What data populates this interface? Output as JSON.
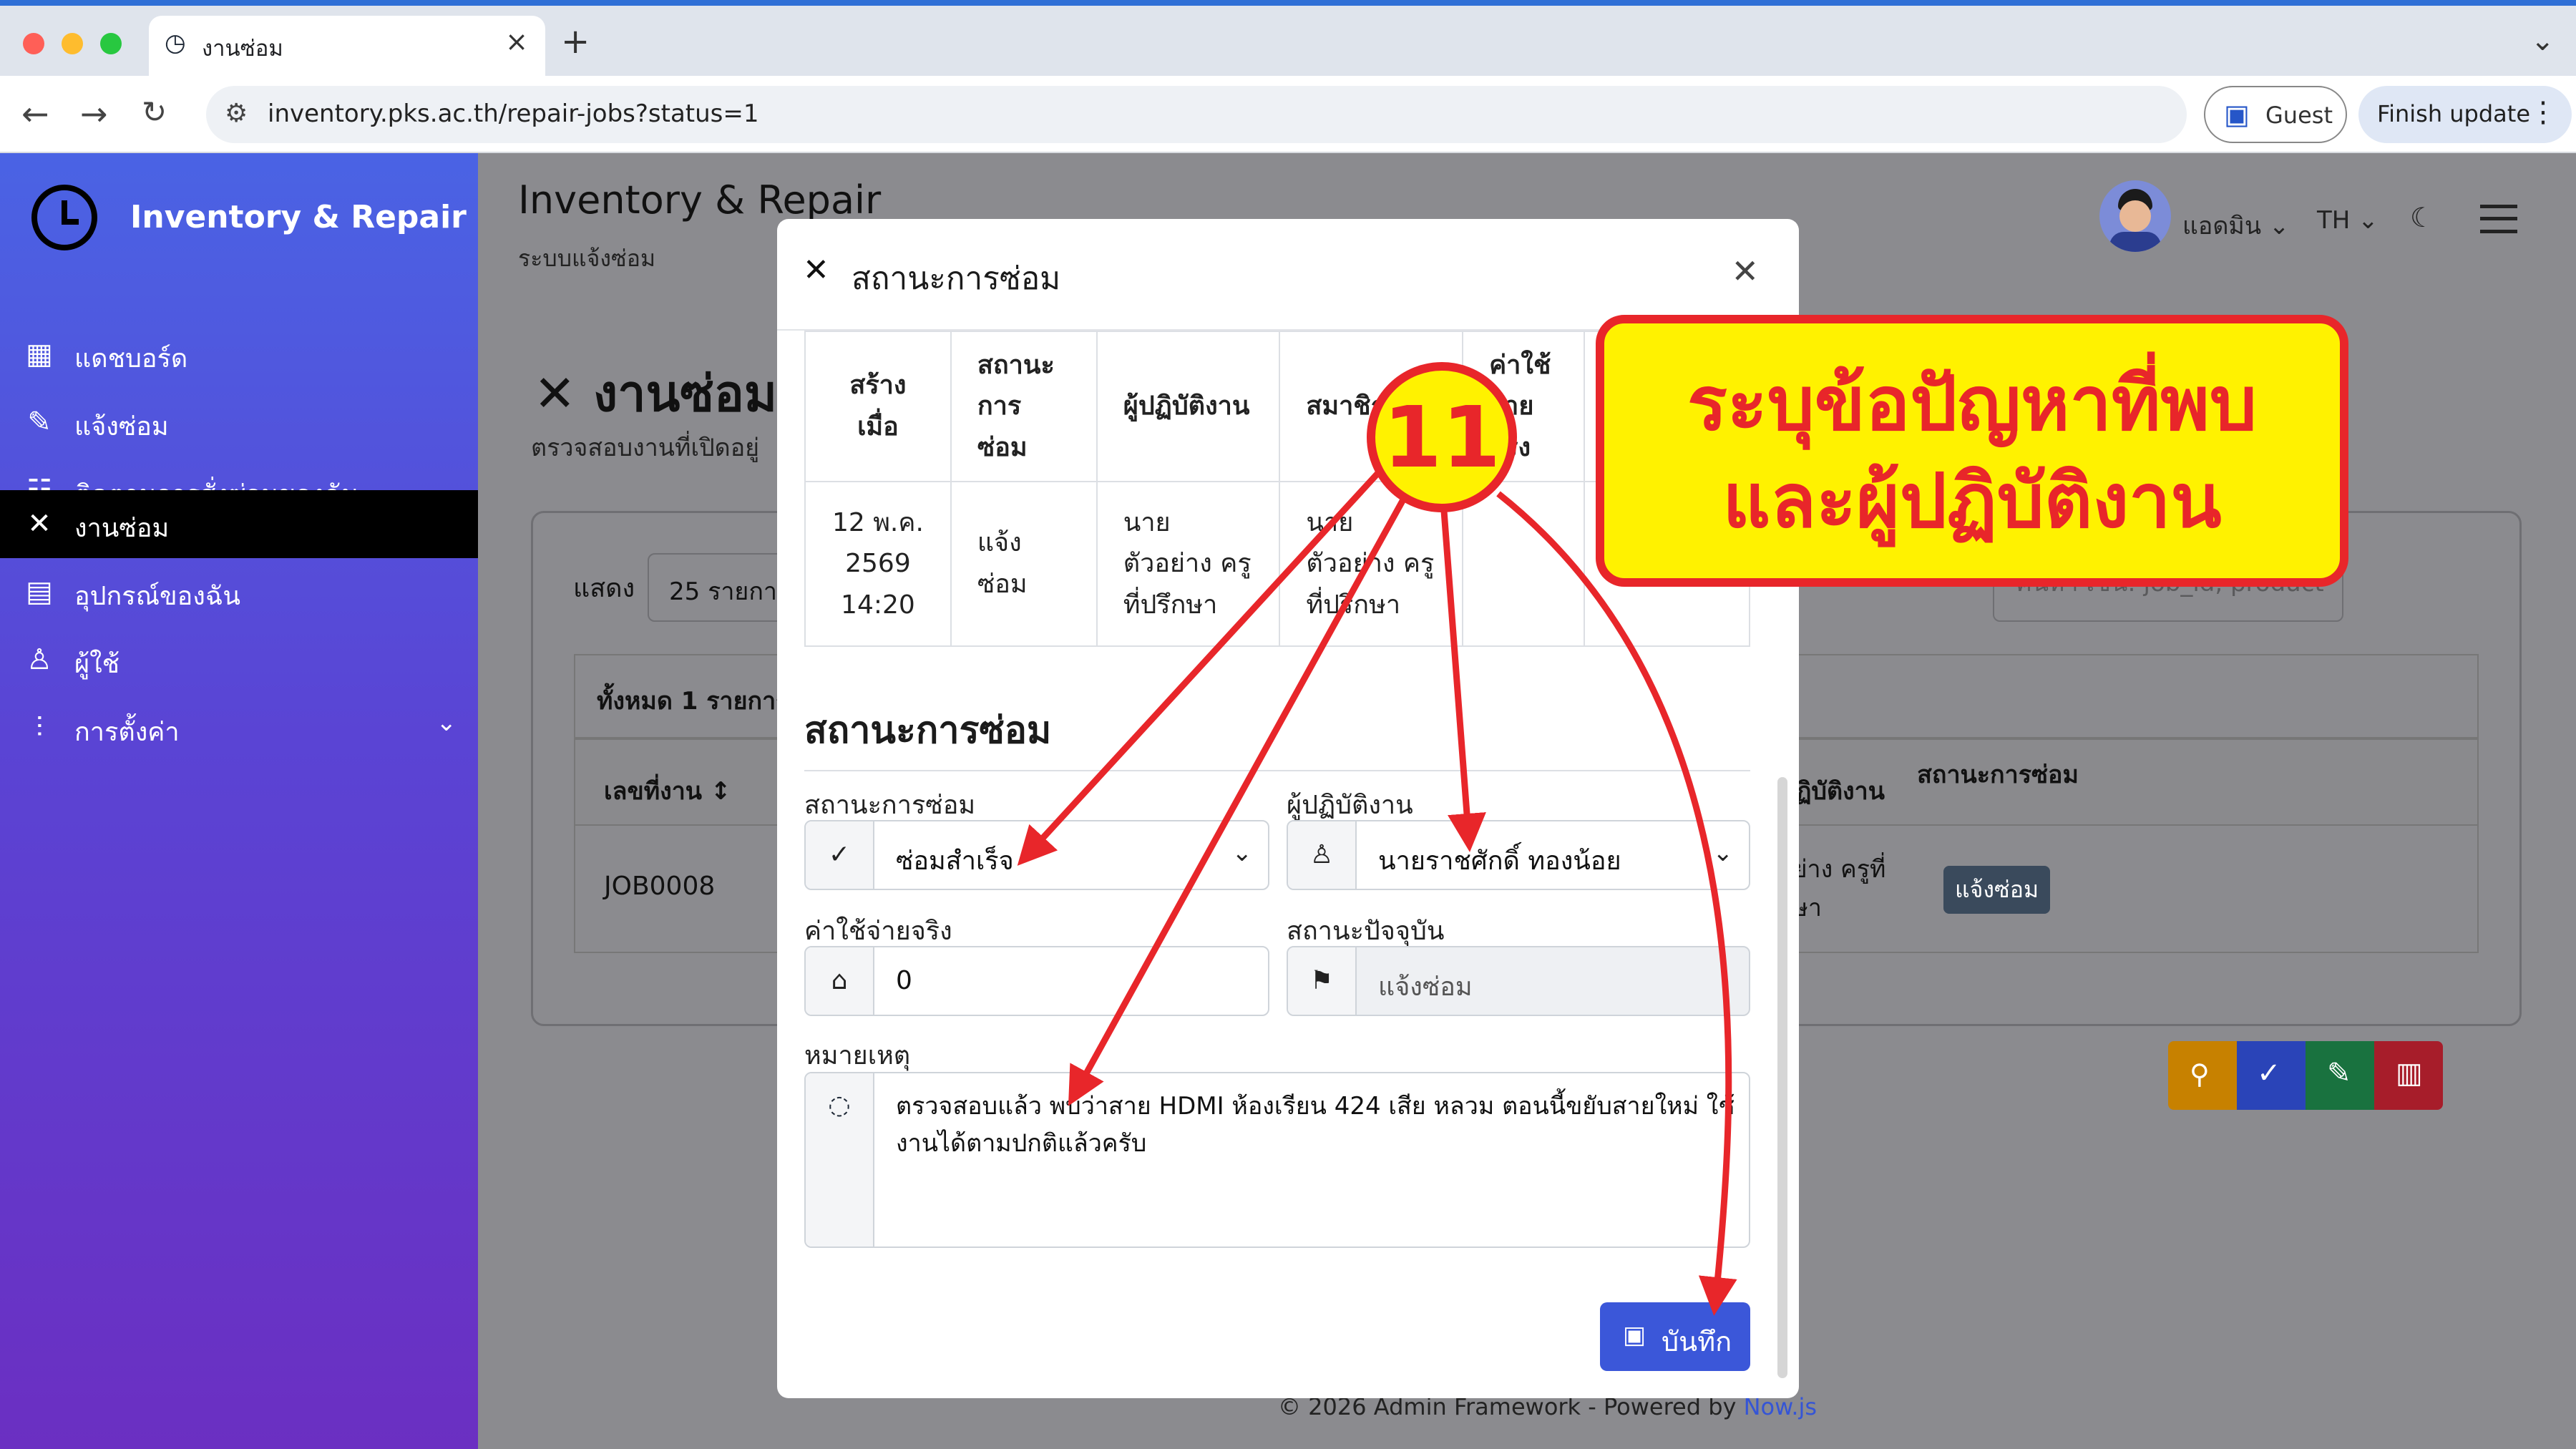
{
  "browser": {
    "tab_title": "งานซ่อม",
    "url": "inventory.pks.ac.th/repair-jobs?status=1",
    "guest_label": "Guest",
    "finish_update_label": "Finish update"
  },
  "sidebar": {
    "brand": "Inventory & Repair",
    "items": [
      {
        "label": "แดชบอร์ด",
        "icon": "dashboard-icon"
      },
      {
        "label": "แจ้งซ่อม",
        "icon": "report-icon"
      },
      {
        "label": "ติดตามการสั่งซ่อมของฉัน",
        "icon": "checklist-icon"
      },
      {
        "label": "งานซ่อม",
        "icon": "tools-icon",
        "active": true
      },
      {
        "label": "อุปกรณ์ของฉัน",
        "icon": "store-icon"
      },
      {
        "label": "ผู้ใช้",
        "icon": "users-icon"
      },
      {
        "label": "การตั้งค่า",
        "icon": "settings-icon"
      }
    ]
  },
  "header": {
    "title": "Inventory & Repair",
    "subtitle": "ระบบแจ้งซ่อม",
    "user": "แอดมิน",
    "lang": "TH"
  },
  "page": {
    "heading": "งานซ่อม",
    "subheading": "ตรวจสอบงานที่เปิดอยู่",
    "show_label": "แสดง",
    "page_size": "25 รายการ",
    "search_placeholder": "ค้นหา เช่น: job_id, product",
    "total_label": "ทั้งหมด 1 รายการ",
    "col_job": "เลขที่งาน",
    "col_technician": "ผู้ปฏิบัติงาน",
    "col_status": "สถานะการซ่อม",
    "row_job": "JOB0008",
    "row_technician": "ตัวอย่าง ครูที่ปรึกษา",
    "row_status": "แจ้งซ่อม"
  },
  "footer": {
    "text": "© 2026 Admin Framework - Powered by ",
    "link": "Now.js"
  },
  "modal": {
    "title": "สถานะการซ่อม",
    "table": {
      "headers": [
        "สร้างเมื่อ",
        "สถานะการซ่อม",
        "ผู้ปฏิบัติงาน",
        "สมาชิก",
        "ค่าใช้จ่ายจริง"
      ],
      "row": [
        "12 พ.ค. 2569 14:20",
        "แจ้งซ่อม",
        "นาย ตัวอย่าง ครูที่ปรึกษา",
        "นาย ตัวอย่าง ครูที่ปรึกษา",
        ""
      ]
    },
    "section_title": "สถานะการซ่อม",
    "status_label": "สถานะการซ่อม",
    "status_value": "ซ่อมสำเร็จ",
    "technician_label": "ผู้ปฏิบัติงาน",
    "technician_value": "นายราชศักดิ์ ทองน้อย",
    "cost_label": "ค่าใช้จ่ายจริง",
    "cost_value": "0",
    "current_status_label": "สถานะปัจจุบัน",
    "current_status_value": "แจ้งซ่อม",
    "note_label": "หมายเหตุ",
    "note_value": "ตรวจสอบแล้ว พบว่าสาย HDMI ห้องเรียน 424 เสีย หลวม ตอนนี้ขยับสายใหม่ ใช้งานได้ตามปกติแล้วครับ",
    "save_label": "บันทึก"
  },
  "annotation": {
    "step": "11",
    "line1": "ระบุข้อปัญหาที่พบ",
    "line2": "และผู้ปฏิบัติงาน"
  },
  "colors": {
    "accent": "#3b57d9",
    "callout_fill": "#fff200",
    "callout_border": "#e8262a"
  }
}
